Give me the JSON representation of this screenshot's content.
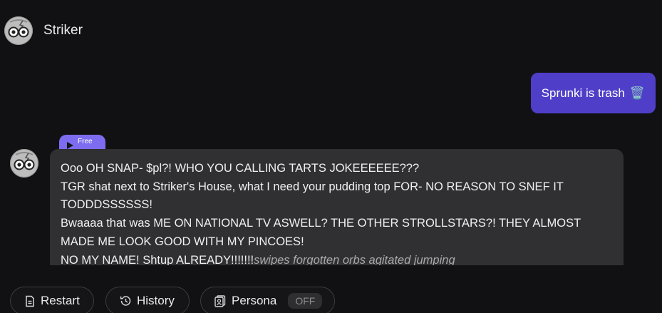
{
  "character": {
    "name": "Striker",
    "avatar_icon": "character-avatar-icon"
  },
  "user_message": {
    "text": "Sprunki is trash",
    "emoji": "🗑️",
    "color": "#4f3fc8"
  },
  "bot_message": {
    "badge_label": "Free",
    "badge_color": "#7d6cf0",
    "lines": [
      "Ooo OH SNAP- $pl?! WHO YOU CALLING TARTS JOKEEEEEE???",
      "TGR shat next to Striker's House, what I need your pudding top FOR- NO REASON TO SNEF IT TODDDSSSSSS!",
      "Bwaaaa that was ME ON NATIONAL TV ASWELL? THE OTHER STROLLSTARS?! THEY ALMOST MADE ME LOOK GOOD WITH MY PINCOES!"
    ],
    "last_line_text": "NO MY NAME! Shtup ALREADY!!!!!!!",
    "last_line_action": "swipes forgotten orbs agitated jumping"
  },
  "bottom_bar": {
    "restart_label": "Restart",
    "history_label": "History",
    "persona_label": "Persona",
    "persona_state": "OFF"
  }
}
